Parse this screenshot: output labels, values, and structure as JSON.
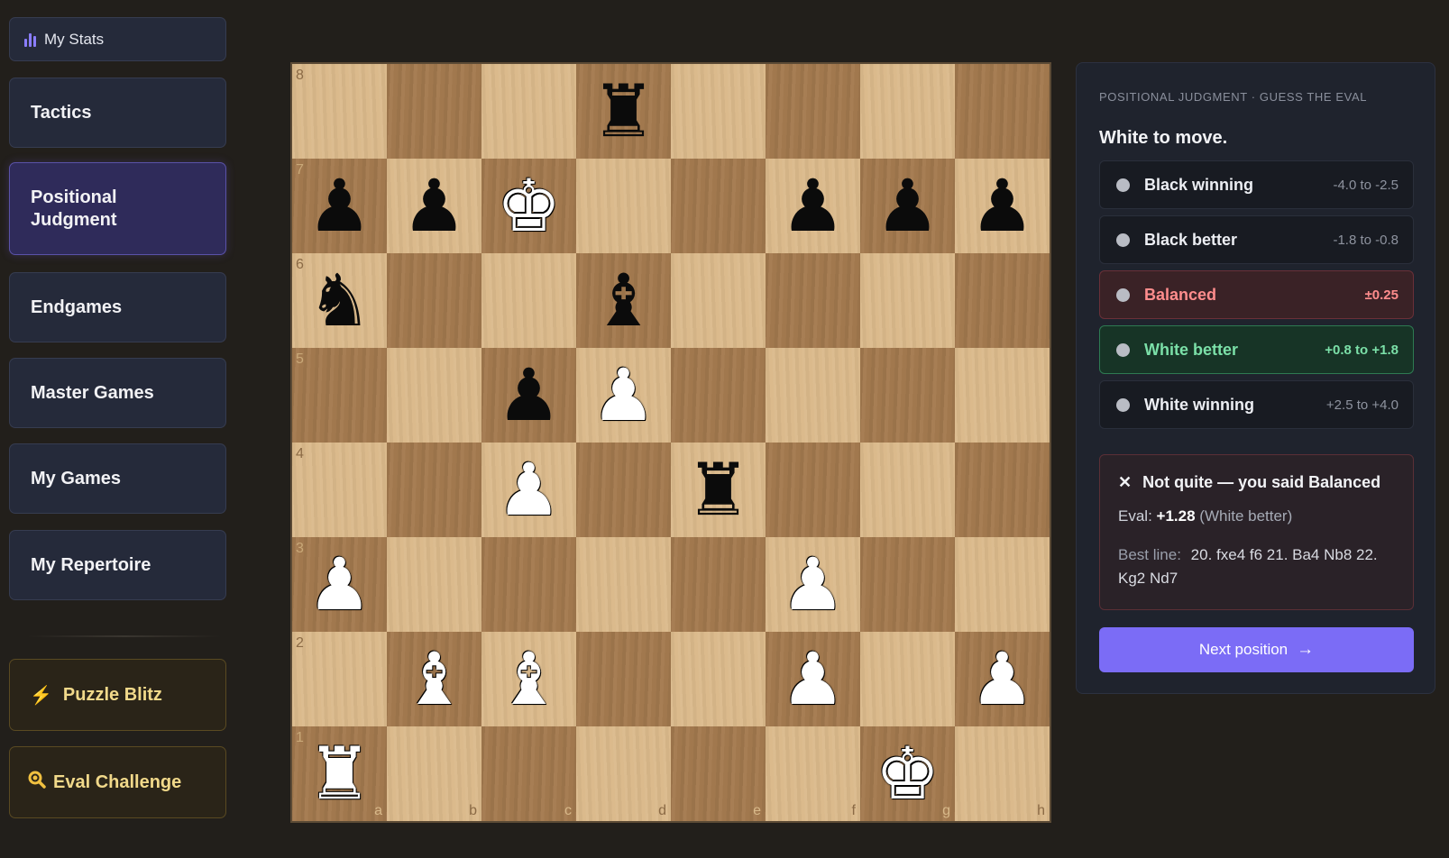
{
  "sidebar": {
    "stats_label": "My Stats",
    "items": [
      {
        "label": "Tactics"
      },
      {
        "label": "Positional Judgment"
      },
      {
        "label": "Endgames"
      },
      {
        "label": "Master Games"
      },
      {
        "label": "My Games"
      },
      {
        "label": "My Repertoire"
      }
    ],
    "special": [
      {
        "label": "Puzzle Blitz",
        "icon": "lightning-icon"
      },
      {
        "label": "Eval Challenge",
        "icon": "magnifier-icon"
      }
    ]
  },
  "board": {
    "files": [
      "a",
      "b",
      "c",
      "d",
      "e",
      "f",
      "g",
      "h"
    ],
    "ranks": [
      "8",
      "7",
      "6",
      "5",
      "4",
      "3",
      "2",
      "1"
    ],
    "pieces": [
      {
        "square": "d8",
        "piece": "rook",
        "color": "black",
        "glyph": "♜"
      },
      {
        "square": "a7",
        "piece": "pawn",
        "color": "black",
        "glyph": "♟"
      },
      {
        "square": "b7",
        "piece": "pawn",
        "color": "black",
        "glyph": "♟"
      },
      {
        "square": "c7",
        "piece": "king",
        "color": "white",
        "glyph": "♚"
      },
      {
        "square": "f7",
        "piece": "pawn",
        "color": "black",
        "glyph": "♟"
      },
      {
        "square": "g7",
        "piece": "pawn",
        "color": "black",
        "glyph": "♟"
      },
      {
        "square": "h7",
        "piece": "pawn",
        "color": "black",
        "glyph": "♟"
      },
      {
        "square": "a6",
        "piece": "knight",
        "color": "black",
        "glyph": "♞"
      },
      {
        "square": "d6",
        "piece": "bishop",
        "color": "black",
        "glyph": "♝"
      },
      {
        "square": "c5",
        "piece": "pawn",
        "color": "black",
        "glyph": "♟"
      },
      {
        "square": "d5",
        "piece": "pawn",
        "color": "white",
        "glyph": "♟"
      },
      {
        "square": "c4",
        "piece": "pawn",
        "color": "white",
        "glyph": "♟"
      },
      {
        "square": "e4",
        "piece": "rook",
        "color": "black",
        "glyph": "♜"
      },
      {
        "square": "a3",
        "piece": "pawn",
        "color": "white",
        "glyph": "♟"
      },
      {
        "square": "f3",
        "piece": "pawn",
        "color": "white",
        "glyph": "♟"
      },
      {
        "square": "b2",
        "piece": "bishop",
        "color": "white",
        "glyph": "♝"
      },
      {
        "square": "c2",
        "piece": "bishop",
        "color": "white",
        "glyph": "♝"
      },
      {
        "square": "f2",
        "piece": "pawn",
        "color": "white",
        "glyph": "♟"
      },
      {
        "square": "h2",
        "piece": "pawn",
        "color": "white",
        "glyph": "♟"
      },
      {
        "square": "a1",
        "piece": "rook",
        "color": "white",
        "glyph": "♜"
      },
      {
        "square": "g1",
        "piece": "king",
        "color": "white",
        "glyph": "♚"
      }
    ]
  },
  "panel": {
    "kicker": "POSITIONAL JUDGMENT · GUESS THE EVAL",
    "title": "White to move.",
    "options": [
      {
        "label": "Black winning",
        "range": "-4.0 to -2.5",
        "state": "normal"
      },
      {
        "label": "Black better",
        "range": "-1.8 to -0.8",
        "state": "normal"
      },
      {
        "label": "Balanced",
        "range": "±0.25",
        "state": "wrong"
      },
      {
        "label": "White better",
        "range": "+0.8 to +1.8",
        "state": "right"
      },
      {
        "label": "White winning",
        "range": "+2.5 to +4.0",
        "state": "normal"
      }
    ],
    "feedback": {
      "heading": "Not quite — you said Balanced",
      "eval_label": "Eval:",
      "eval_value": "+1.28",
      "eval_note": "(White better)",
      "best_line_label": "Best line:",
      "best_line": "20. fxe4 f6 21. Ba4 Nb8 22. Kg2 Nd7"
    },
    "next_label": "Next position"
  },
  "colors": {
    "accent": "#7b6cf6",
    "wrong": "#ff8d8d",
    "right": "#7be0a8",
    "gold": "#f1d98a"
  }
}
